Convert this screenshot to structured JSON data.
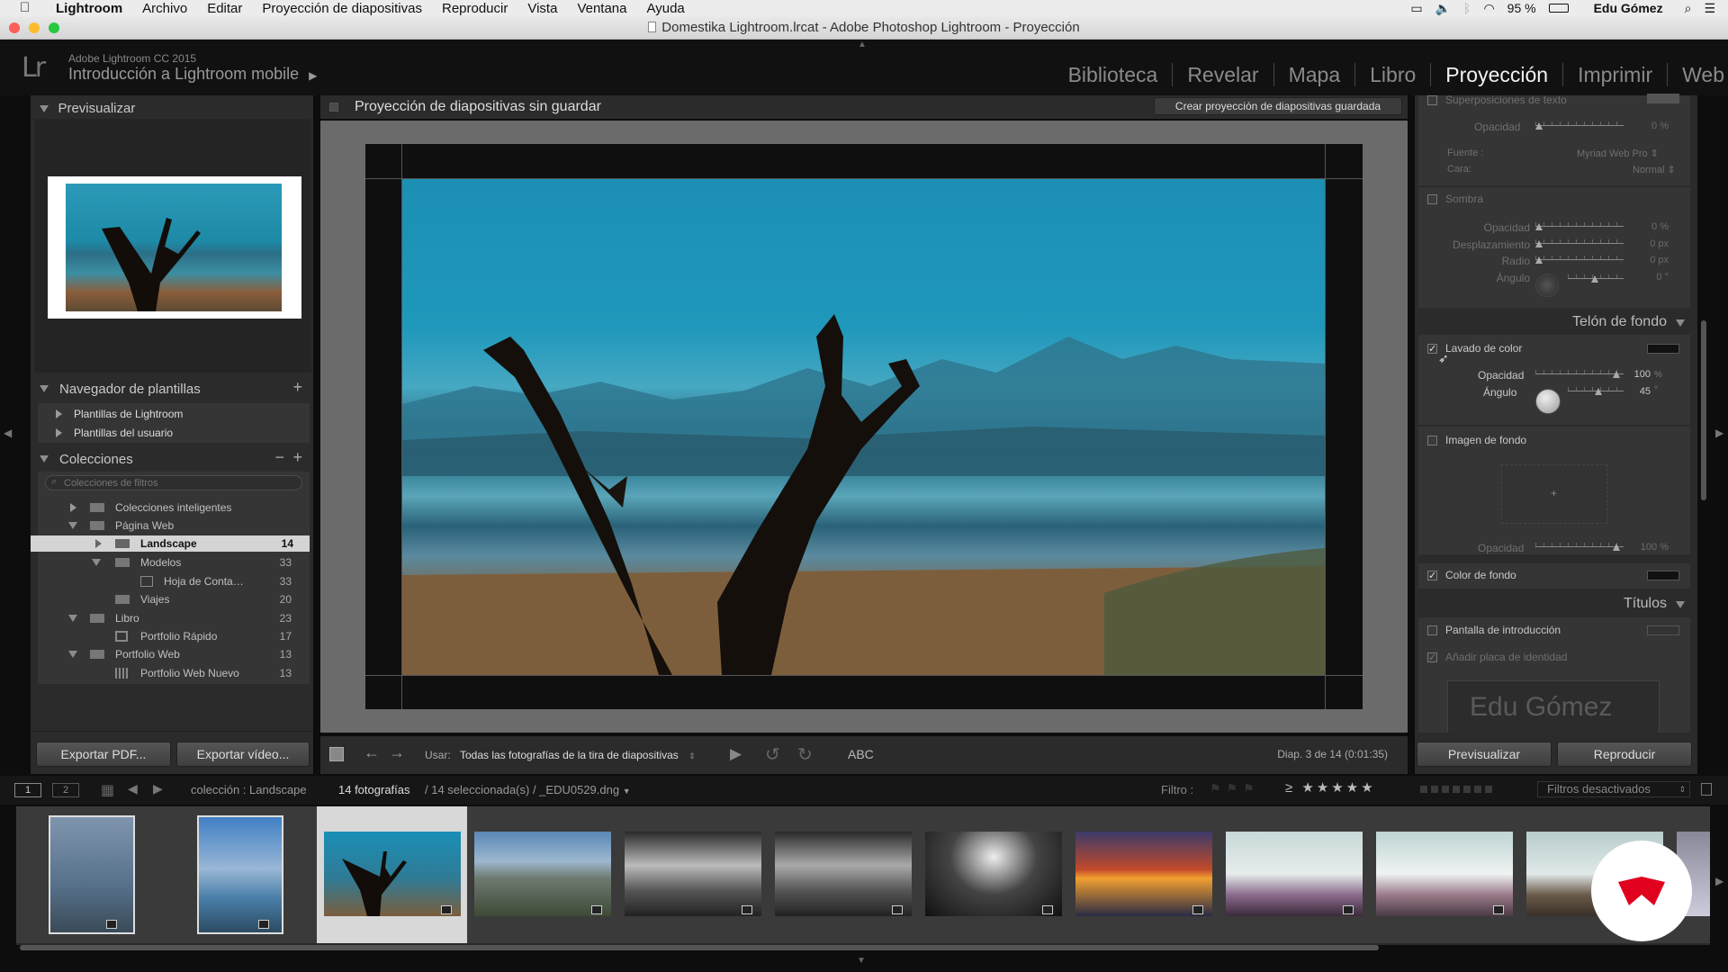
{
  "menubar": {
    "apple": "",
    "app": "Lightroom",
    "items": [
      "Archivo",
      "Editar",
      "Proyección de diapositivas",
      "Reproducir",
      "Vista",
      "Ventana",
      "Ayuda"
    ],
    "battery": "95 %",
    "user": "Edu Gómez"
  },
  "window": {
    "title": "Domestika Lightroom.lrcat - Adobe Photoshop Lightroom - Proyección"
  },
  "identity": {
    "logo": "Lr",
    "version": "Adobe Lightroom CC 2015",
    "catalog": "Introducción a Lightroom mobile"
  },
  "modules": [
    {
      "label": "Biblioteca"
    },
    {
      "label": "Revelar"
    },
    {
      "label": "Mapa"
    },
    {
      "label": "Libro"
    },
    {
      "label": "Proyección"
    },
    {
      "label": "Imprimir"
    },
    {
      "label": "Web"
    }
  ],
  "left": {
    "preview_title": "Previsualizar",
    "template_browser": {
      "title": "Navegador de plantillas",
      "items": [
        "Plantillas de Lightroom",
        "Plantillas del usuario"
      ]
    },
    "collections": {
      "title": "Colecciones",
      "search_placeholder": "Colecciones de filtros",
      "rows": [
        {
          "label": "Colecciones inteligentes",
          "count": ""
        },
        {
          "label": "Página Web",
          "count": ""
        },
        {
          "label": "Landscape",
          "count": "14"
        },
        {
          "label": "Modelos",
          "count": "33"
        },
        {
          "label": "Hoja de Conta…",
          "count": "33"
        },
        {
          "label": "Viajes",
          "count": "20"
        },
        {
          "label": "Libro",
          "count": "23"
        },
        {
          "label": "Portfolio Rápido",
          "count": "17"
        },
        {
          "label": "Portfolio Web",
          "count": "13"
        },
        {
          "label": "Portfolio Web Nuevo",
          "count": "13"
        }
      ]
    },
    "export_pdf": "Exportar PDF...",
    "export_video": "Exportar vídeo..."
  },
  "center": {
    "title": "Proyección de diapositivas sin guardar",
    "save_btn": "Crear proyección de diapositivas guardada",
    "toolbar": {
      "use_label": "Usar:",
      "use_value": "Todas las fotografías de la tira de diapositivas",
      "abc": "ABC",
      "status": "Diap. 3 de 14 (0:01:35)"
    }
  },
  "right": {
    "overlay_text": {
      "title": "Superposiciones de texto",
      "opacity_label": "Opacidad",
      "opacity_value": "0 %",
      "font_label": "Fuente :",
      "font_value": "Myriad Web Pro",
      "face_label": "Cara:",
      "face_value": "Normal"
    },
    "shadow": {
      "title": "Sombra",
      "labels": [
        "Opacidad",
        "Desplazamiento",
        "Radio",
        "Ángulo"
      ],
      "values": [
        "0 %",
        "0 px",
        "0 px",
        "0 °"
      ]
    },
    "backdrop": {
      "title": "Telón de fondo",
      "color_wash": {
        "title": "Lavado de color",
        "opacity_label": "Opacidad",
        "opacity_value": "100",
        "opacity_unit": "%",
        "angle_label": "Ángulo",
        "angle_value": "45",
        "angle_unit": "°"
      },
      "bg_image": {
        "title": "Imagen de fondo",
        "opacity_label": "Opacidad",
        "opacity_value": "100 %"
      },
      "bg_color": {
        "title": "Color de fondo"
      }
    },
    "titles": {
      "title": "Títulos",
      "intro": "Pantalla de introducción",
      "identity": "Añadir placa de identidad",
      "identity_name": "Edu Gómez"
    },
    "preview_btn": "Previsualizar",
    "play_btn": "Reproducir"
  },
  "filmbar": {
    "screen1": "1",
    "screen2": "2",
    "source": "colección : Landscape",
    "count": "14 fotografías",
    "selection": "/ 14 seleccionada(s) / _EDU0529.dng",
    "filter_label": "Filtro :",
    "filters_off": "Filtros desactivados"
  },
  "colors": {
    "accent": "#e1001e",
    "panel": "#2b2b2b",
    "background": "#0d0d0d"
  }
}
